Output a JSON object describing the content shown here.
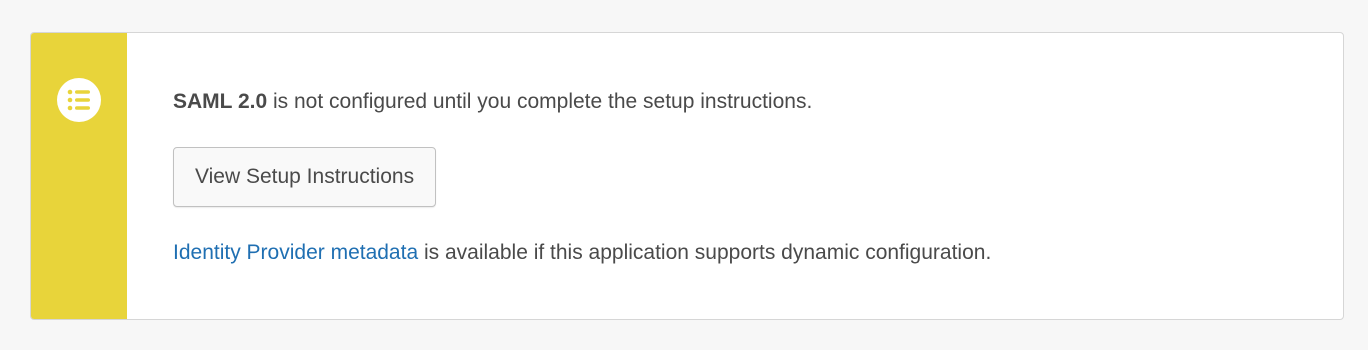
{
  "colors": {
    "stripe": "#e8d43a",
    "link": "#1f6fb2",
    "text": "#4a4a4a",
    "background": "#f7f7f7",
    "card": "#ffffff"
  },
  "callout": {
    "icon": "list-icon",
    "message": {
      "product_name": "SAML 2.0",
      "text": " is not configured until you complete the setup instructions."
    },
    "button_label": "View Setup Instructions",
    "metadata": {
      "link_text": "Identity Provider metadata",
      "text": " is available if this application supports dynamic configuration."
    }
  }
}
